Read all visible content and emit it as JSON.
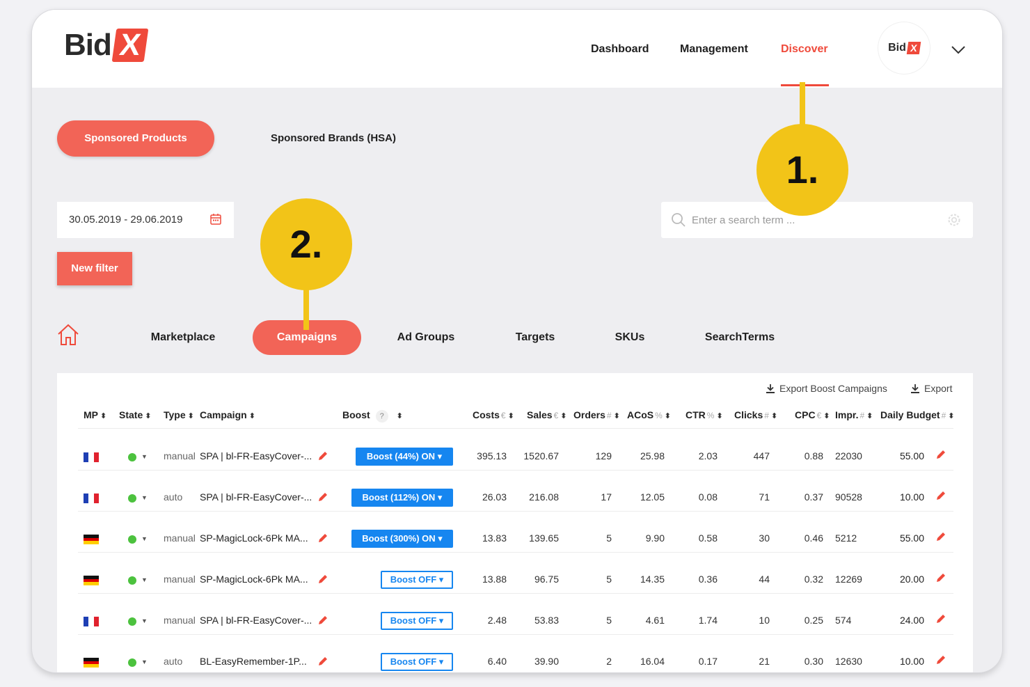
{
  "app": {
    "logo_text": "Bid",
    "logo_mark": "X",
    "accent_color": "#ef4a3b",
    "boost_color": "#1686f0"
  },
  "nav": {
    "dashboard": "Dashboard",
    "management": "Management",
    "discover": "Discover",
    "avatar_text": "Bid",
    "avatar_mark": "X"
  },
  "product_tabs": {
    "sponsored_products": "Sponsored Products",
    "sponsored_brands": "Sponsored Brands (HSA)"
  },
  "filters": {
    "date_range": "30.05.2019 - 29.06.2019",
    "search_placeholder": "Enter a search term ...",
    "new_filter": "New filter"
  },
  "tabs": {
    "marketplace": "Marketplace",
    "campaigns": "Campaigns",
    "ad_groups": "Ad Groups",
    "targets": "Targets",
    "skus": "SKUs",
    "search_terms": "SearchTerms"
  },
  "annotations": {
    "one": "1.",
    "two": "2."
  },
  "table": {
    "export_boost": "Export Boost Campaigns",
    "export": "Export",
    "help_mark": "?",
    "headers": {
      "mp": "MP",
      "state": "State",
      "type": "Type",
      "campaign": "Campaign",
      "boost": "Boost",
      "costs": "Costs",
      "costs_unit": "€",
      "sales": "Sales",
      "sales_unit": "€",
      "orders": "Orders",
      "orders_unit": "#",
      "acos": "ACoS",
      "acos_unit": "%",
      "ctr": "CTR",
      "ctr_unit": "%",
      "clicks": "Clicks",
      "clicks_unit": "#",
      "cpc": "CPC",
      "cpc_unit": "€",
      "impr": "Impr.",
      "impr_unit": "#",
      "daily_budget": "Daily Budget",
      "daily_budget_unit": "#"
    },
    "rows": [
      {
        "mp": "fr",
        "type": "manual",
        "campaign": "SPA | bl-FR-EasyCover-...",
        "boost": "Boost (44%) ON ▾",
        "boost_on": true,
        "costs": "395.13",
        "sales": "1520.67",
        "orders": "129",
        "acos": "25.98",
        "ctr": "2.03",
        "clicks": "447",
        "cpc": "0.88",
        "impr": "22030",
        "budget": "55.00"
      },
      {
        "mp": "fr",
        "type": "auto",
        "campaign": "SPA | bl-FR-EasyCover-...",
        "boost": "Boost (112%) ON ▾",
        "boost_on": true,
        "costs": "26.03",
        "sales": "216.08",
        "orders": "17",
        "acos": "12.05",
        "ctr": "0.08",
        "clicks": "71",
        "cpc": "0.37",
        "impr": "90528",
        "budget": "10.00"
      },
      {
        "mp": "de",
        "type": "manual",
        "campaign": "SP-MagicLock-6Pk MA...",
        "boost": "Boost (300%) ON ▾",
        "boost_on": true,
        "costs": "13.83",
        "sales": "139.65",
        "orders": "5",
        "acos": "9.90",
        "ctr": "0.58",
        "clicks": "30",
        "cpc": "0.46",
        "impr": "5212",
        "budget": "55.00"
      },
      {
        "mp": "de",
        "type": "manual",
        "campaign": "SP-MagicLock-6Pk MA...",
        "boost": "Boost OFF ▾",
        "boost_on": false,
        "costs": "13.88",
        "sales": "96.75",
        "orders": "5",
        "acos": "14.35",
        "ctr": "0.36",
        "clicks": "44",
        "cpc": "0.32",
        "impr": "12269",
        "budget": "20.00"
      },
      {
        "mp": "fr",
        "type": "manual",
        "campaign": "SPA | bl-FR-EasyCover-...",
        "boost": "Boost OFF ▾",
        "boost_on": false,
        "costs": "2.48",
        "sales": "53.83",
        "orders": "5",
        "acos": "4.61",
        "ctr": "1.74",
        "clicks": "10",
        "cpc": "0.25",
        "impr": "574",
        "budget": "24.00"
      },
      {
        "mp": "de",
        "type": "auto",
        "campaign": "BL-EasyRemember-1P...",
        "boost": "Boost OFF ▾",
        "boost_on": false,
        "costs": "6.40",
        "sales": "39.90",
        "orders": "2",
        "acos": "16.04",
        "ctr": "0.17",
        "clicks": "21",
        "cpc": "0.30",
        "impr": "12630",
        "budget": "10.00"
      }
    ]
  }
}
